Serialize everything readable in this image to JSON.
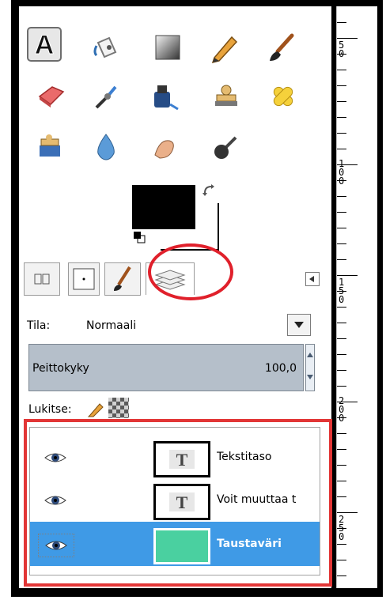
{
  "toolbox": {
    "tools": [
      {
        "icon": "text-tool-icon"
      },
      {
        "icon": "bucket-fill-icon"
      },
      {
        "icon": "blend-gradient-icon"
      },
      {
        "icon": "pencil-icon"
      },
      {
        "icon": "paintbrush-icon"
      },
      {
        "icon": "eraser-icon"
      },
      {
        "icon": "airbrush-icon"
      },
      {
        "icon": "ink-icon"
      },
      {
        "icon": "clone-stamp-icon"
      },
      {
        "icon": "heal-icon"
      },
      {
        "icon": "perspective-clone-icon"
      },
      {
        "icon": "blur-icon"
      },
      {
        "icon": "smudge-icon"
      },
      {
        "icon": "dodge-burn-icon"
      }
    ],
    "foreground_color": "#000000",
    "background_color": "#ffffff"
  },
  "dock_tabs": [
    {
      "icon": "tool-options-icon"
    },
    {
      "icon": "brushes-icon"
    },
    {
      "icon": "paint-icon"
    },
    {
      "icon": "layers-icon"
    }
  ],
  "layer_options": {
    "mode_label": "Tila:",
    "mode_value": "Normaali",
    "opacity_label": "Peittokyky",
    "opacity_value": "100,0",
    "lock_label": "Lukitse:"
  },
  "layers": [
    {
      "name": "Tekstitaso",
      "type": "text"
    },
    {
      "name": "Voit muuttaa t",
      "type": "text"
    },
    {
      "name": "Taustaväri",
      "type": "fill",
      "color": "#4ad0a0",
      "selected": true
    }
  ],
  "ruler_labels": [
    [
      "5",
      "0"
    ],
    [
      "1",
      "0",
      "0"
    ],
    [
      "1",
      "5",
      "0"
    ],
    [
      "2",
      "0",
      "0"
    ],
    [
      "2",
      "5",
      "0"
    ]
  ],
  "colors": {
    "selection": "#3f9ae6",
    "highlight": "#e0202b"
  }
}
